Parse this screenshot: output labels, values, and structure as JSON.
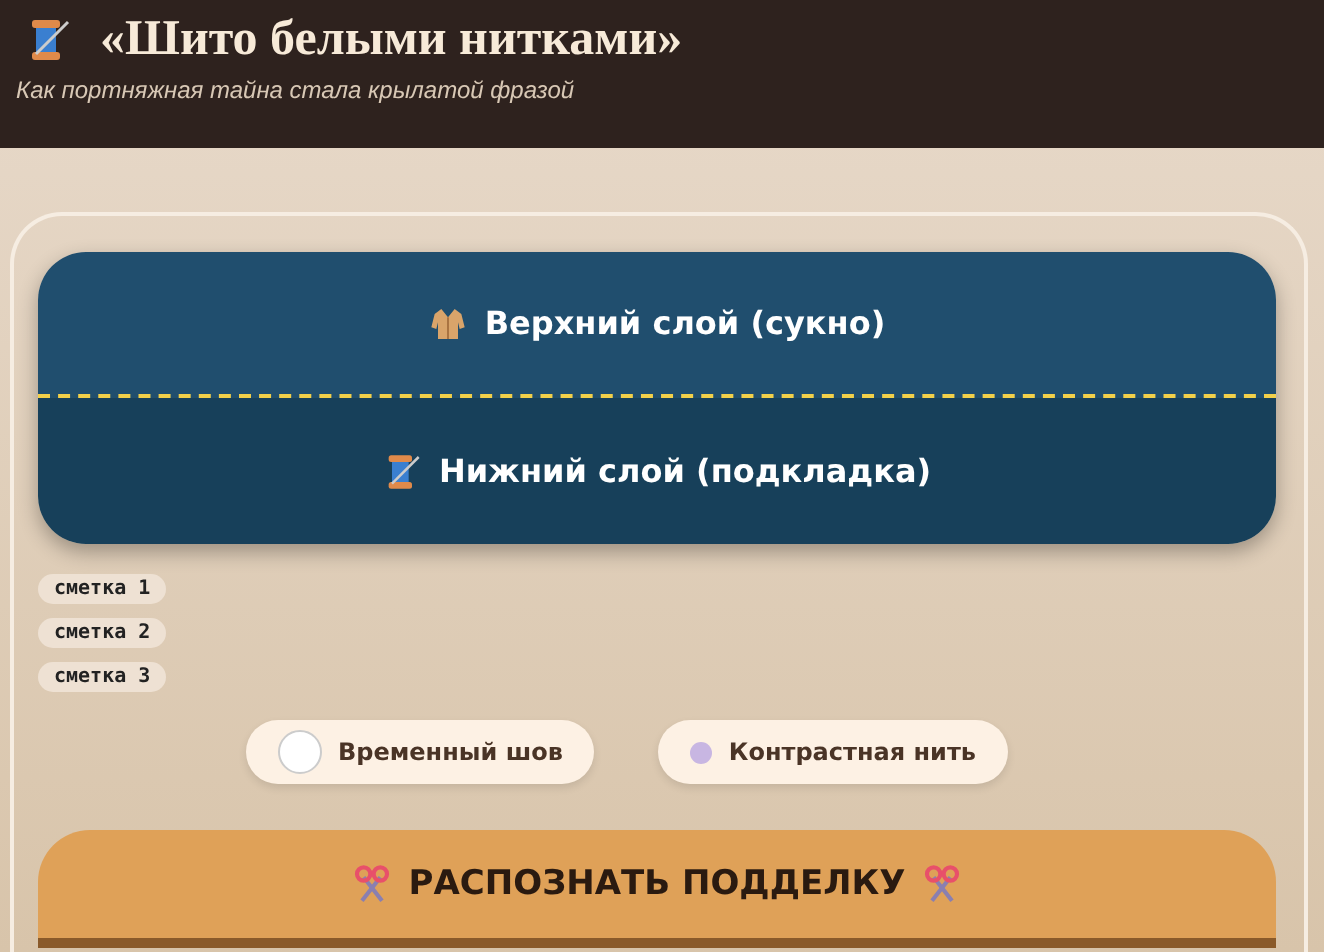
{
  "header": {
    "title": "«Шито белыми нитками»",
    "subtitle": "Как портняжная тайна стала крылатой фразой"
  },
  "layers": [
    {
      "kind": "top",
      "label": "Верхний слой (сукно)"
    },
    {
      "kind": "bottom",
      "label": "Нижний слой (подкладка)"
    }
  ],
  "tags": [
    "сметка 1",
    "сметка 2",
    "сметка 3"
  ],
  "toggles": [
    {
      "label": "Временный шов",
      "kind": "large",
      "color": "#ffffff"
    },
    {
      "label": "Контрастная нить",
      "kind": "small",
      "color": "#c8b6e2"
    }
  ],
  "action": {
    "label": "РАСПОЗНАТЬ ПОДДЕЛКУ"
  }
}
